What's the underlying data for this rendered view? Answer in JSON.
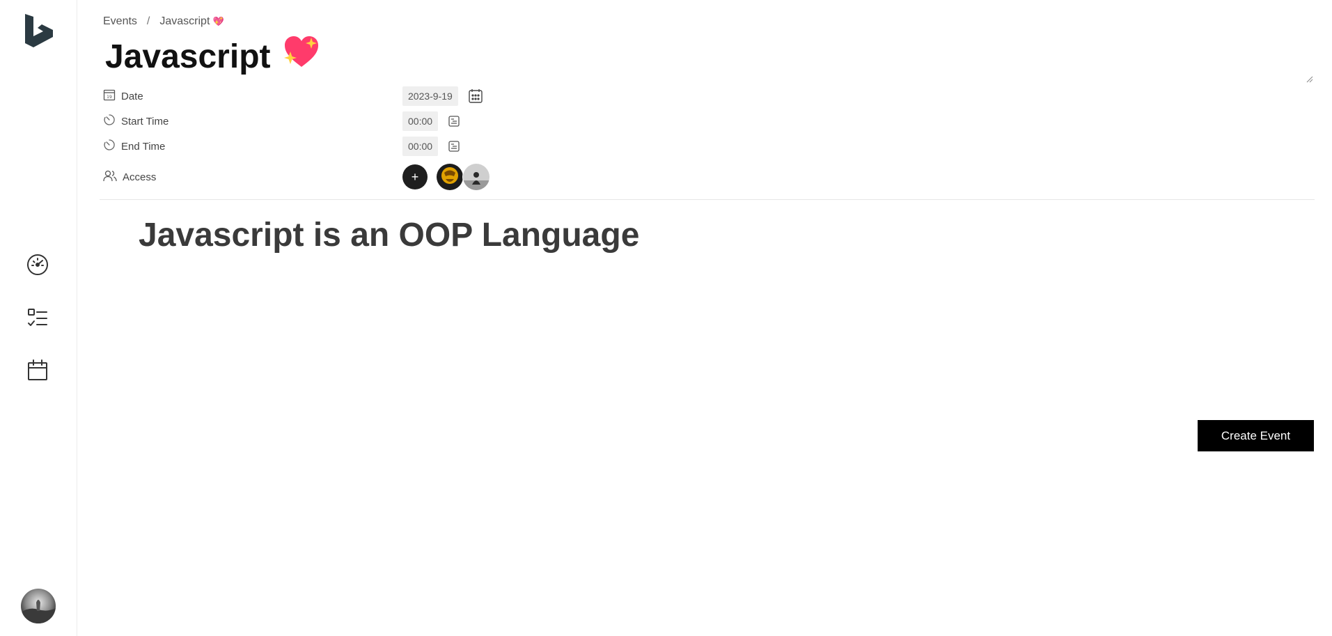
{
  "breadcrumb": {
    "parent": "Events",
    "separator": "/",
    "current": "Javascript",
    "current_emoji": "💖"
  },
  "event": {
    "title": "Javascript",
    "title_emoji": "💖",
    "fields": {
      "date": {
        "label": "Date",
        "value": "2023-9-19",
        "icon": "calendar-day-icon",
        "picker_icon": "calendar-grid-icon"
      },
      "start_time": {
        "label": "Start Time",
        "value": "00:00",
        "icon": "timer-icon",
        "picker_icon": "time-picker-icon"
      },
      "end_time": {
        "label": "End Time",
        "value": "00:00",
        "icon": "timer-icon",
        "picker_icon": "time-picker-icon"
      },
      "access": {
        "label": "Access",
        "icon": "users-icon",
        "add_label": "+"
      }
    },
    "content_heading": "Javascript is an OOP Language"
  },
  "actions": {
    "create_label": "Create Event"
  },
  "sidebar": {
    "items": [
      {
        "name": "dashboard",
        "icon": "gauge-icon"
      },
      {
        "name": "tasks",
        "icon": "checklist-icon"
      },
      {
        "name": "calendar",
        "icon": "calendar-icon"
      }
    ]
  },
  "colors": {
    "accent": "#000000",
    "pill_bg": "#efefef",
    "logo": "#2b3a42",
    "heart": "#ff3b6b"
  }
}
